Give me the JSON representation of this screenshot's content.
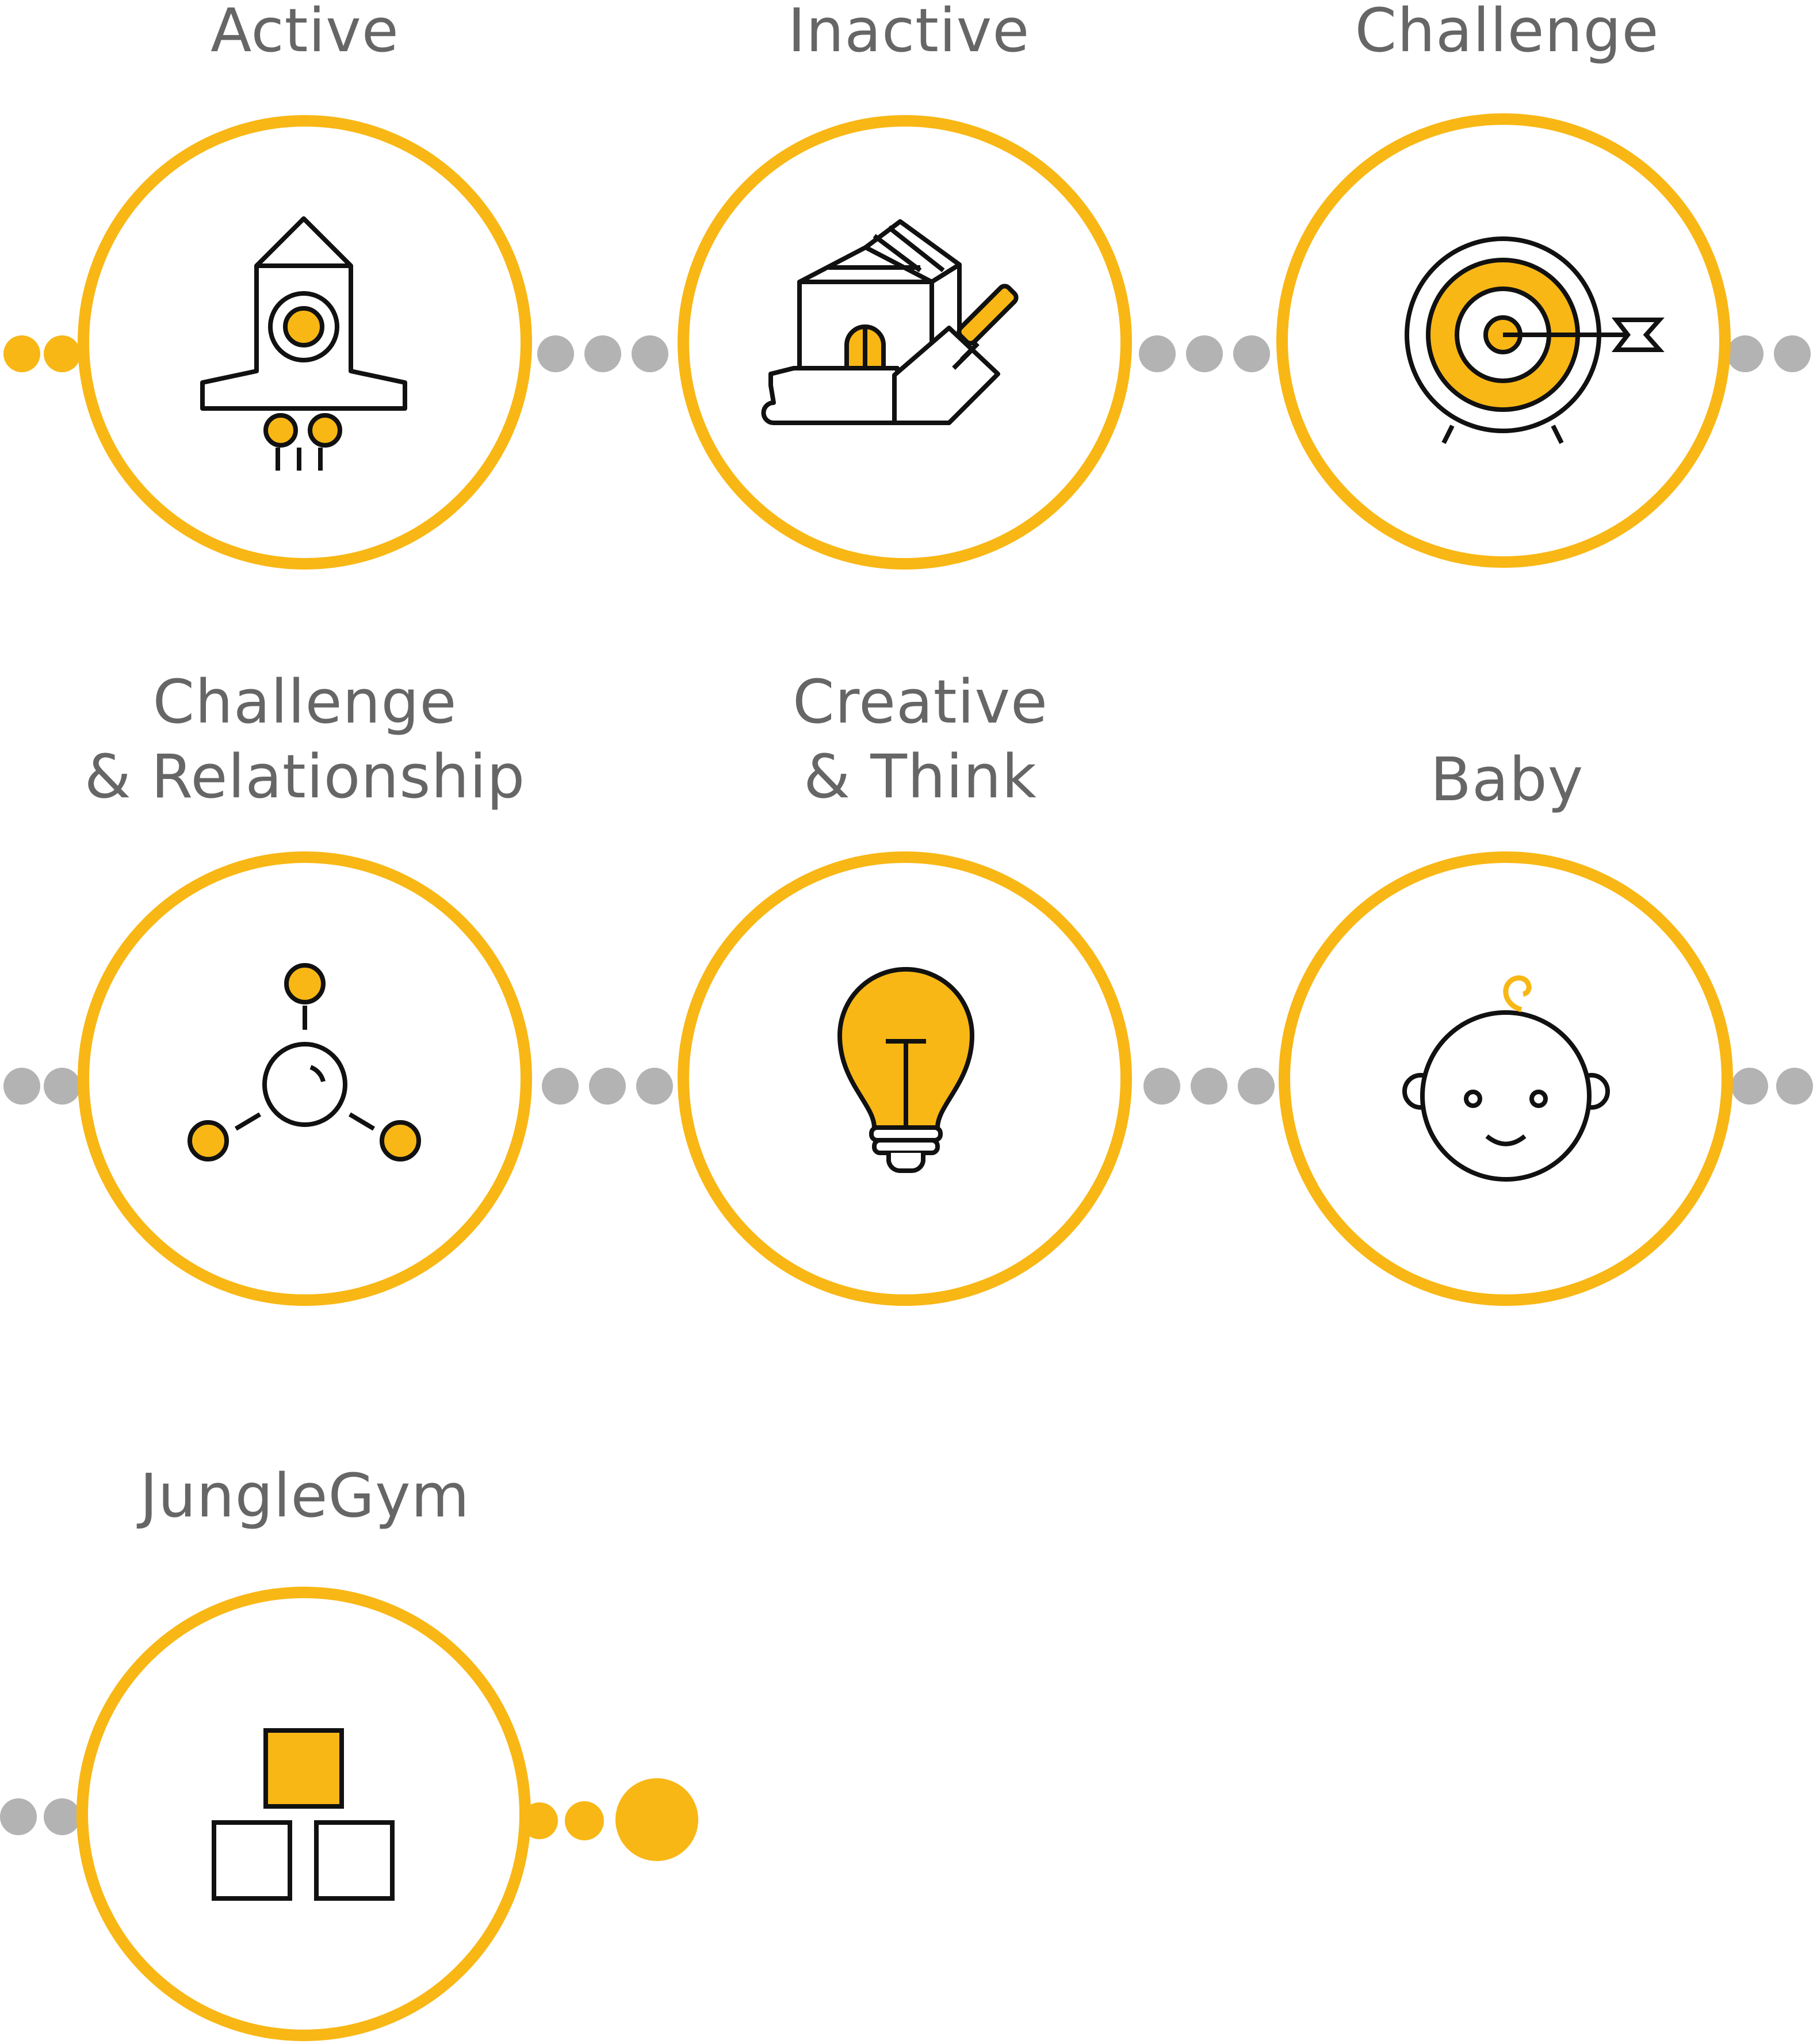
{
  "colors": {
    "accent": "#f8b715",
    "ring": "#f8b715",
    "connector_dot": "#b3b3b3",
    "text": "#666666",
    "stroke": "#111111"
  },
  "categories": [
    {
      "id": "active",
      "label": "Active",
      "icon": "rocket-icon"
    },
    {
      "id": "inactive",
      "label": "Inactive",
      "icon": "house-toolbox-icon"
    },
    {
      "id": "challenge",
      "label": "Challenge",
      "icon": "target-arrow-icon"
    },
    {
      "id": "challenge-relationship",
      "label": "Challenge\n& Relationship",
      "icon": "network-nodes-icon"
    },
    {
      "id": "creative-think",
      "label": "Creative\n& Think",
      "icon": "lightbulb-icon"
    },
    {
      "id": "baby",
      "label": "Baby",
      "icon": "baby-face-icon"
    },
    {
      "id": "junglegym",
      "label": "JungleGym",
      "icon": "stacked-blocks-icon"
    }
  ]
}
